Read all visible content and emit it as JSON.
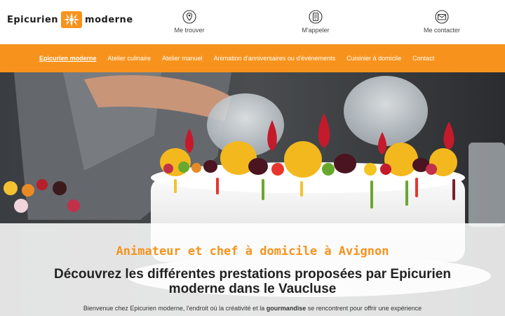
{
  "brand": {
    "name_left": "Epicurien",
    "name_right": "moderne",
    "accent_color": "#f7931d"
  },
  "contacts": [
    {
      "label": "Me trouver",
      "icon": "location-pin-icon"
    },
    {
      "label": "M'appeler",
      "icon": "phone-icon"
    },
    {
      "label": "Me contacter",
      "icon": "mail-icon"
    }
  ],
  "nav": {
    "items": [
      {
        "label": "Epicurien moderne",
        "active": true
      },
      {
        "label": "Atelier culinaire",
        "active": false
      },
      {
        "label": "Atelier manuel",
        "active": false
      },
      {
        "label": "Animation d'anniversaires ou d'événements",
        "active": false
      },
      {
        "label": "Cuisinier à domicile",
        "active": false
      },
      {
        "label": "Contact",
        "active": false
      }
    ]
  },
  "hero": {
    "kicker": "Animateur et chef à domicile à Avignon",
    "title": "Découvrez les différentes prestations proposées par Epicurien moderne dans le Vaucluse",
    "intro_before": "Bienvenue chez Epicurien moderne, l'endroit où la créativité et la ",
    "intro_bold": "gourmandise",
    "intro_after": " se rencontrent pour offrir une expérience"
  }
}
